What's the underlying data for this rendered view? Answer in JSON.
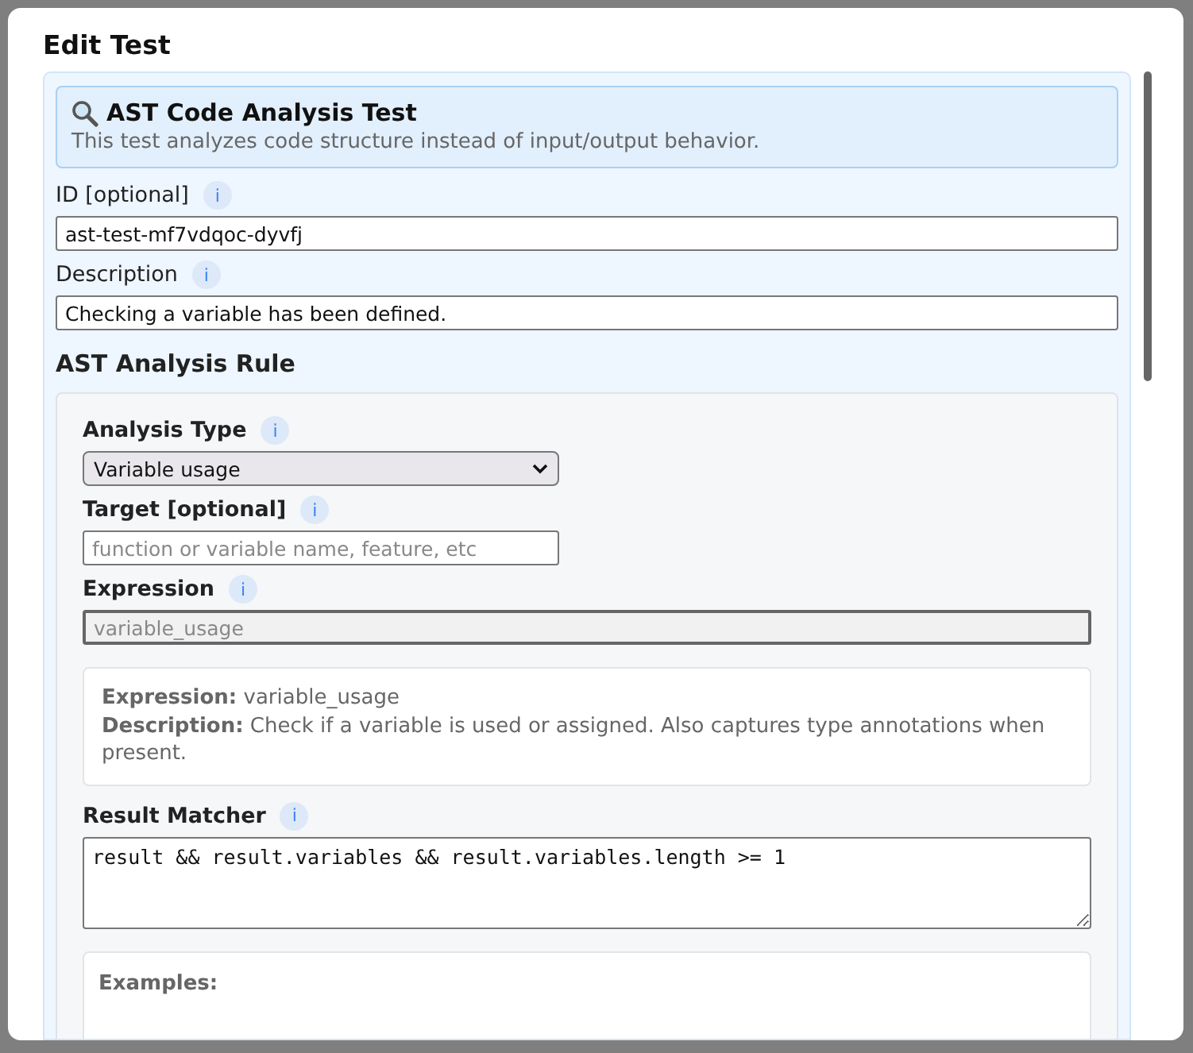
{
  "dialog": {
    "title": "Edit Test",
    "intro": {
      "title": "AST Code Analysis Test",
      "text": "This test analyzes code structure instead of input/output behavior."
    },
    "fields": [
      {
        "kind": "text",
        "label": "ID [optional]",
        "info": "i",
        "value": "ast-test-mf7vdqoc-dyvfj"
      },
      {
        "kind": "text",
        "label": "Description",
        "info": "i",
        "value": "Checking a variable has been defined."
      }
    ],
    "rule": {
      "title": "AST Analysis Rule",
      "fields": [
        {
          "kind": "select",
          "label": "Analysis Type",
          "info": "i",
          "value": "Variable usage"
        },
        {
          "kind": "text",
          "label": "Target [optional]",
          "info": "i",
          "placeholder": "function or variable name, feature, etc"
        },
        {
          "kind": "disabled",
          "label": "Expression",
          "info": "i",
          "placeholder": "variable_usage"
        },
        {
          "kind": "help",
          "lines": [
            {
              "term": "Expression:",
              "text": "variable_usage"
            },
            {
              "term": "Description:",
              "text": "Check if a variable is used or assigned. Also captures type annotations when present."
            }
          ]
        },
        {
          "kind": "code",
          "label": "Result Matcher",
          "info": "i",
          "value": "result && result.variables && result.variables.length >= 1"
        },
        {
          "kind": "examples",
          "title": "Examples:"
        }
      ]
    }
  }
}
